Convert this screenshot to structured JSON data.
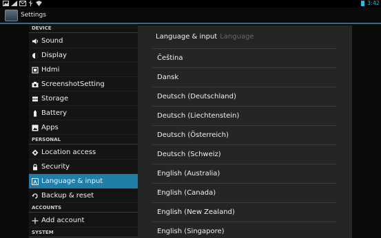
{
  "status_bar": {
    "time": "3:42",
    "left_icons": [
      "gallery-icon",
      "signal-icon",
      "message-icon",
      "usb-icon",
      "wifi-icon"
    ],
    "accent_color": "#33b5e5"
  },
  "action_bar": {
    "title": "Settings"
  },
  "sidebar": {
    "device_header": "DEVICE",
    "device_items": [
      {
        "label": "Sound",
        "icon": "speaker-icon"
      },
      {
        "label": "Display",
        "icon": "display-icon"
      },
      {
        "label": "Hdmi",
        "icon": "hdmi-icon"
      },
      {
        "label": "ScreenshotSetting",
        "icon": "camera-icon"
      },
      {
        "label": "Storage",
        "icon": "storage-icon"
      },
      {
        "label": "Battery",
        "icon": "battery-icon"
      },
      {
        "label": "Apps",
        "icon": "apps-icon"
      }
    ],
    "personal_header": "PERSONAL",
    "personal_items": [
      {
        "label": "Location access",
        "icon": "location-icon"
      },
      {
        "label": "Security",
        "icon": "lock-icon"
      },
      {
        "label": "Language & input",
        "icon": "keyboard-icon",
        "selected": true
      },
      {
        "label": "Backup & reset",
        "icon": "backup-icon"
      }
    ],
    "accounts_header": "ACCOUNTS",
    "accounts_items": [
      {
        "label": "Add account",
        "icon": "plus-icon"
      }
    ],
    "system_header": "SYSTEM",
    "selected_color": "#1f7fa8"
  },
  "dialog": {
    "breadcrumb_parent": "Language & input",
    "breadcrumb_current": "Language",
    "languages": [
      "Čeština",
      "Dansk",
      "Deutsch (Deutschland)",
      "Deutsch (Liechtenstein)",
      "Deutsch (Österreich)",
      "Deutsch (Schweiz)",
      "English (Australia)",
      "English (Canada)",
      "English (New Zealand)",
      "English (Singapore)"
    ]
  }
}
